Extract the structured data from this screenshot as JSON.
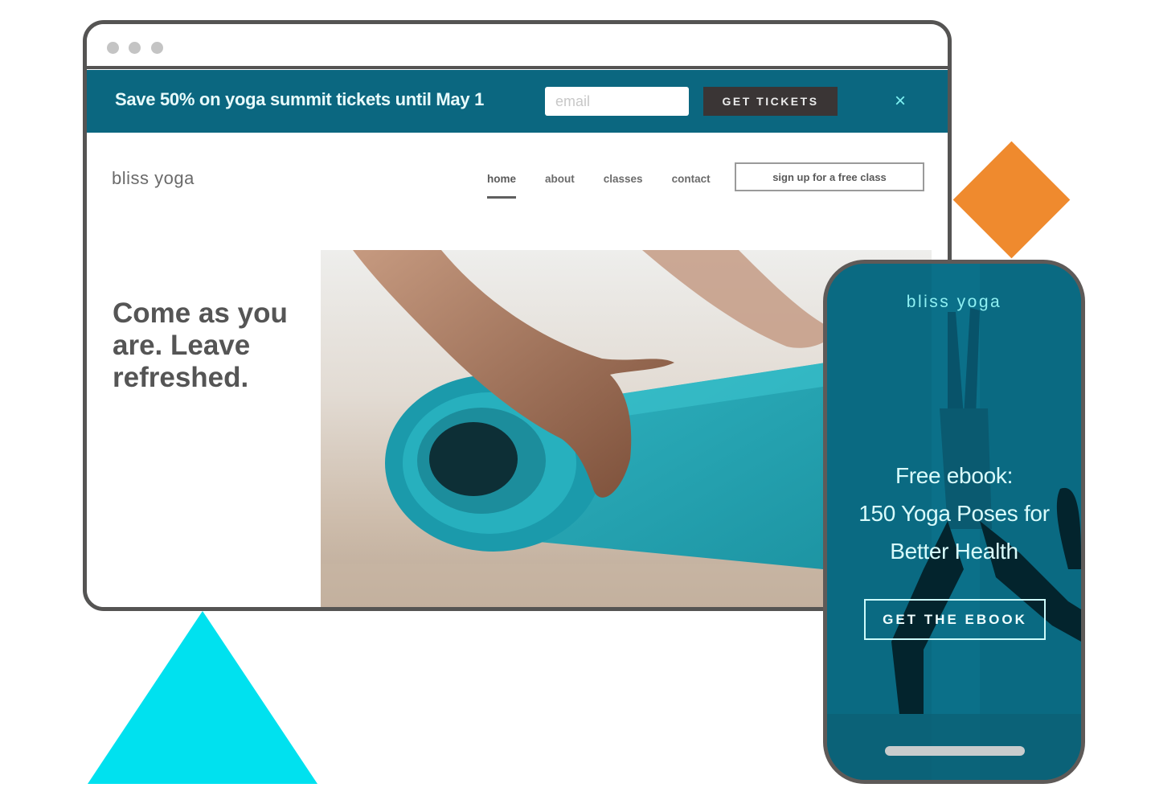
{
  "colors": {
    "brand_teal": "#0b6780",
    "accent_cyan": "#00e1ef",
    "accent_orange": "#ef8a2e",
    "frame_gray": "#555453",
    "dark_button": "#3a3535"
  },
  "browser": {
    "window_dots": [
      "close",
      "minimize",
      "maximize"
    ],
    "promo_bar": {
      "message": "Save 50% on yoga summit tickets until May 1",
      "email_placeholder": "email",
      "email_value": "",
      "cta_label": "GET TICKETS",
      "close_icon": "×"
    },
    "site": {
      "logo": "bliss yoga",
      "nav": [
        {
          "label": "home",
          "active": true
        },
        {
          "label": "about",
          "active": false
        },
        {
          "label": "classes",
          "active": false
        },
        {
          "label": "contact",
          "active": false
        }
      ],
      "signup_label": "sign up for a free class",
      "hero_heading": "Come as you are. Leave refreshed.",
      "hero_image": "hands rolling teal yoga mat"
    }
  },
  "phone": {
    "logo": "bliss yoga",
    "heading_lines": [
      "Free ebook:",
      "150 Yoga Poses for",
      "Better Health"
    ],
    "cta_label": "GET THE EBOOK",
    "background_image": "person in warrior yoga pose, teal tint"
  }
}
